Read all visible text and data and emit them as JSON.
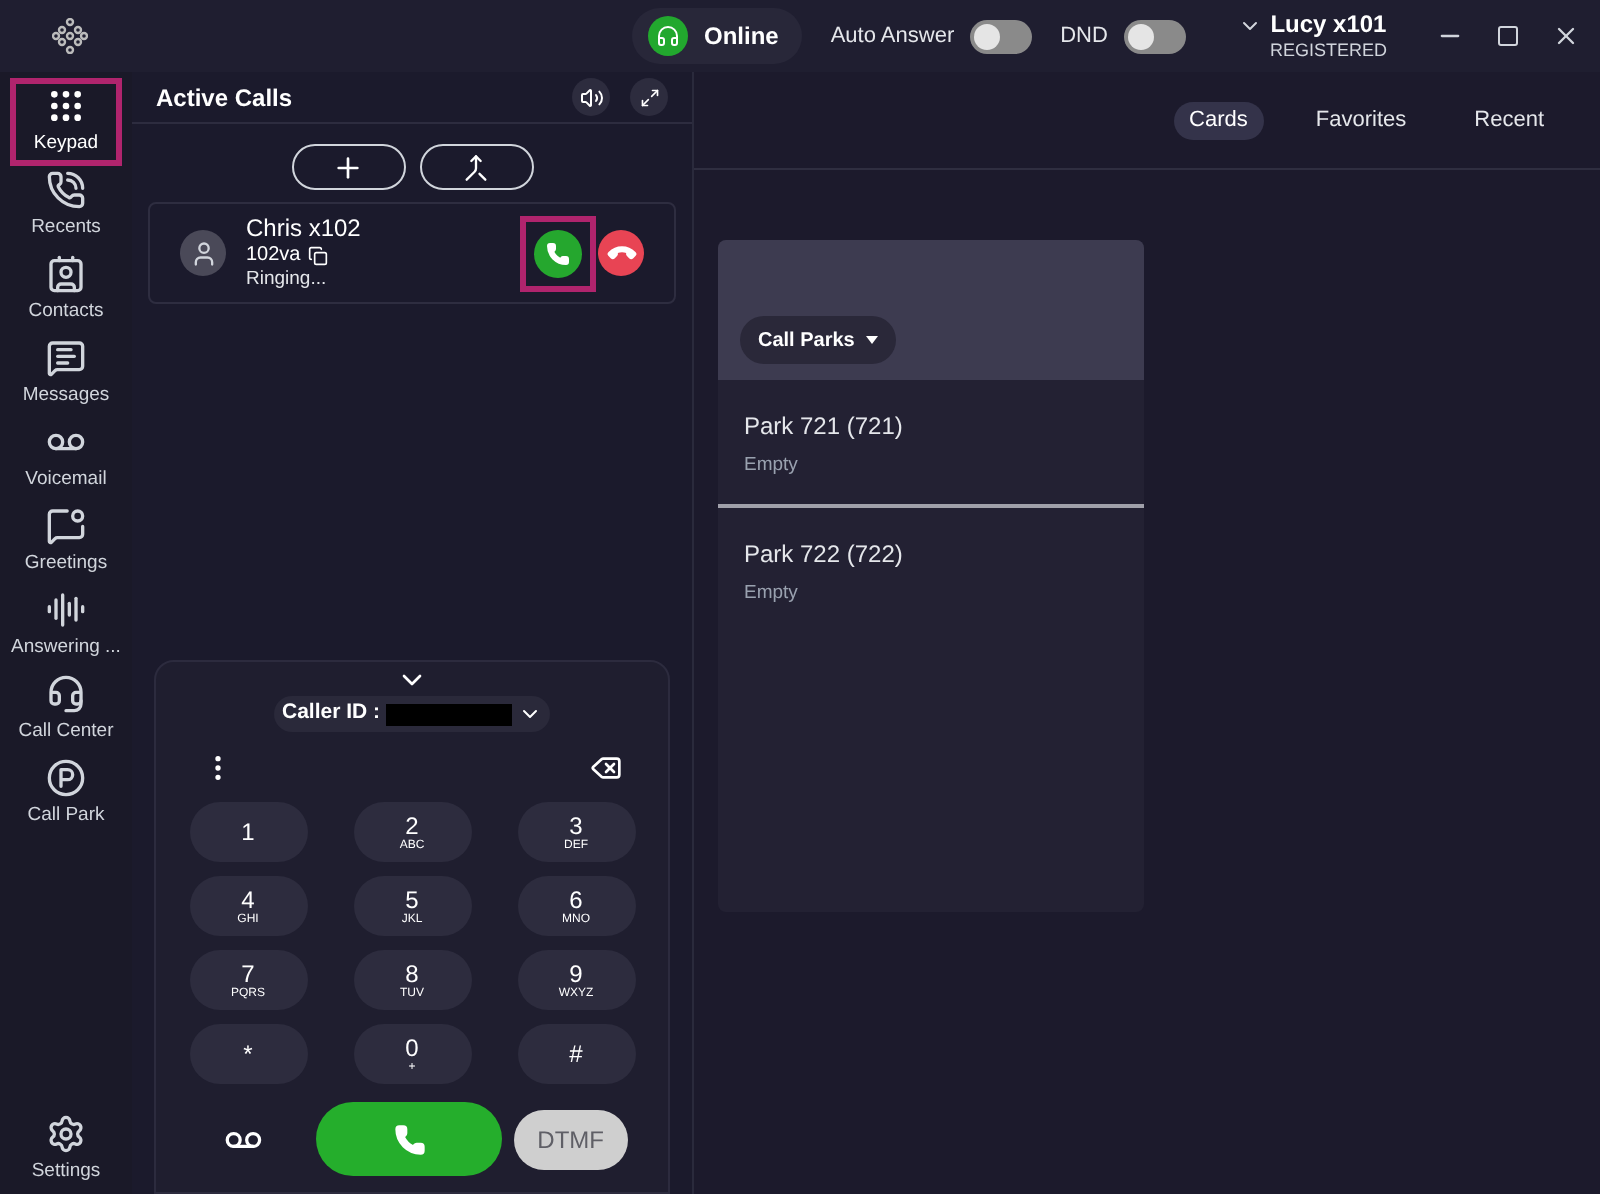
{
  "top_bar": {
    "status": "Online",
    "toggles": [
      {
        "label": "Auto Answer",
        "on": false
      },
      {
        "label": "DND",
        "on": false
      }
    ],
    "user": {
      "name": "Lucy x101",
      "status": "REGISTERED"
    }
  },
  "sidebar": {
    "items": [
      {
        "label": "Keypad",
        "kind": "keypad",
        "selected": true,
        "highlighted": true
      },
      {
        "label": "Recents",
        "kind": "recents",
        "selected": false,
        "highlighted": false
      },
      {
        "label": "Contacts",
        "kind": "contacts",
        "selected": false,
        "highlighted": false
      },
      {
        "label": "Messages",
        "kind": "messages",
        "selected": false,
        "highlighted": false
      },
      {
        "label": "Voicemail",
        "kind": "voicemail",
        "selected": false,
        "highlighted": false
      },
      {
        "label": "Greetings",
        "kind": "greetings",
        "selected": false,
        "highlighted": false
      },
      {
        "label": "Answering ...",
        "kind": "answering",
        "selected": false,
        "highlighted": false
      },
      {
        "label": "Call Center",
        "kind": "callcenter",
        "selected": false,
        "highlighted": false
      },
      {
        "label": "Call Park",
        "kind": "callpark",
        "selected": false,
        "highlighted": false
      }
    ],
    "settings": "Settings"
  },
  "active_calls": {
    "title": "Active Calls",
    "calls": [
      {
        "name": "Chris x102",
        "number": "102va",
        "status": "Ringing...",
        "answer_highlighted": true
      }
    ]
  },
  "dialpad": {
    "caller_id_label": "Caller ID :",
    "keys": [
      {
        "digit": "1"
      },
      {
        "digit": "2",
        "letters": "ABC"
      },
      {
        "digit": "3",
        "letters": "DEF"
      },
      {
        "digit": "4",
        "letters": "GHI"
      },
      {
        "digit": "5",
        "letters": "JKL"
      },
      {
        "digit": "6",
        "letters": "MNO"
      },
      {
        "digit": "7",
        "letters": "PQRS"
      },
      {
        "digit": "8",
        "letters": "TUV"
      },
      {
        "digit": "9",
        "letters": "WXYZ"
      },
      {
        "digit": "*"
      },
      {
        "digit": "0",
        "letters": "+"
      },
      {
        "digit": "#"
      }
    ],
    "dtmf": {
      "label": "DTMF",
      "disabled": true
    }
  },
  "tabs": [
    {
      "label": "Cards",
      "selected": true
    },
    {
      "label": "Favorites",
      "selected": false
    },
    {
      "label": "Recent",
      "selected": false
    }
  ],
  "card": {
    "dropdown": "Call Parks",
    "rows": [
      {
        "title": "Park 721 (721)",
        "status": "Empty"
      },
      {
        "title": "Park 722 (722)",
        "status": "Empty"
      }
    ]
  }
}
